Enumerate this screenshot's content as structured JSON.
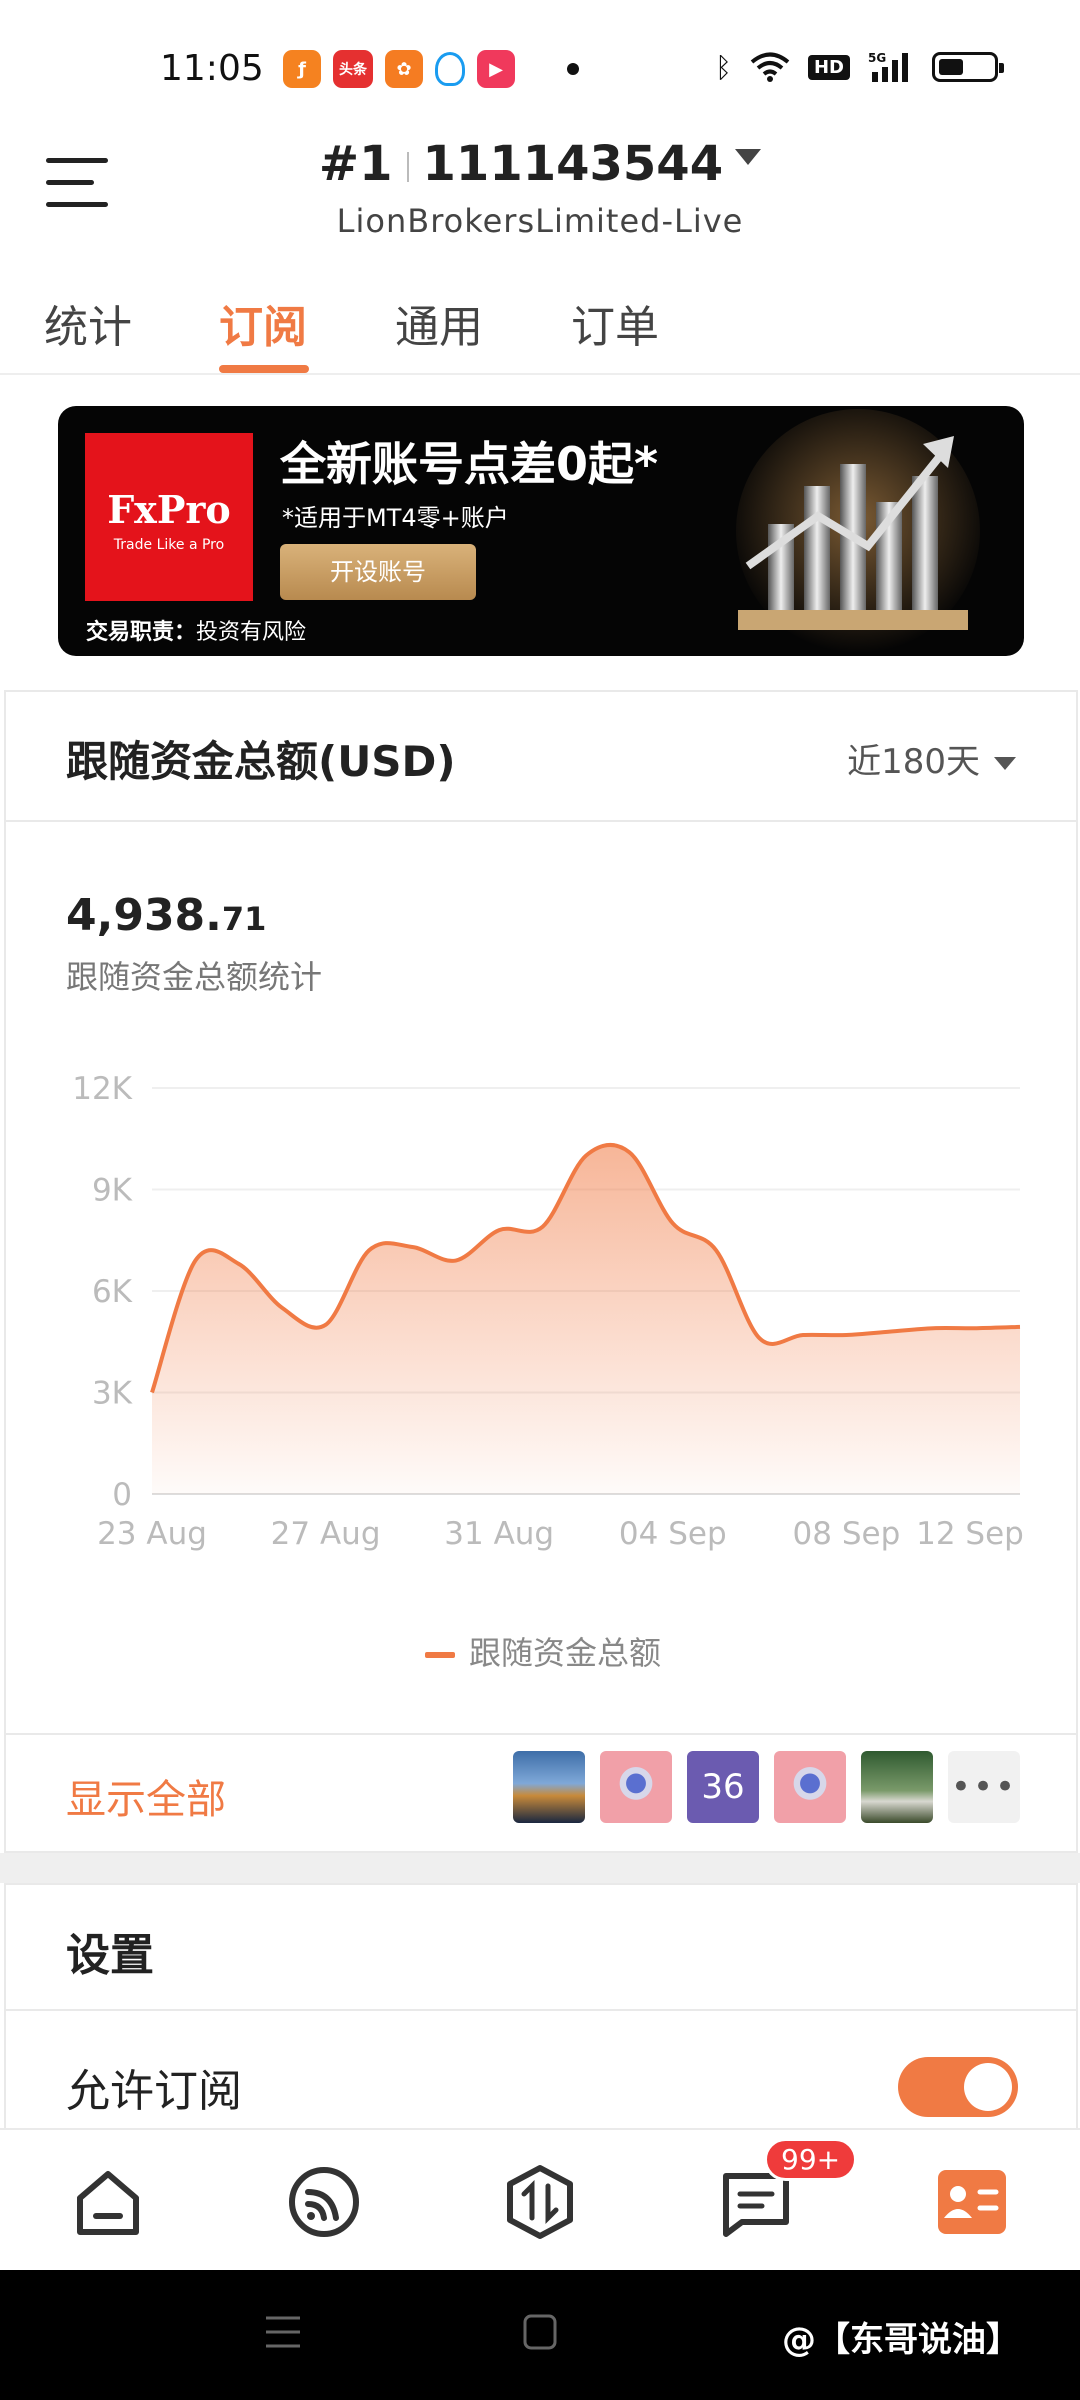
{
  "status_bar": {
    "time": "11:05",
    "app_icons": [
      "flame-app-icon",
      "toutiao-app-icon",
      "fan-app-icon",
      "qq-app-icon",
      "video-app-icon"
    ],
    "toutiao_label": "头条",
    "hd_label": "HD",
    "network_label": "5G"
  },
  "header": {
    "account_index": "#1",
    "account_number": "111143544",
    "server": "LionBrokersLimited-Live"
  },
  "tabs": [
    {
      "label": "统计"
    },
    {
      "label": "订阅"
    },
    {
      "label": "通用"
    },
    {
      "label": "订单"
    }
  ],
  "active_tab": "订阅",
  "banner": {
    "brand": "FxPro",
    "tagline": "Trade Like a Pro",
    "headline": "全新账号点差0起*",
    "subline": "*适用于MT4零+账户",
    "button": "开设账号",
    "risk_label": "交易职责：",
    "risk_text": "投资有风险"
  },
  "funds_card": {
    "title": "跟随资金总额(USD)",
    "range": "近180天",
    "total_int": "4,938.",
    "total_dec": "71",
    "total_label": "跟随资金总额统计",
    "legend": "跟随资金总额"
  },
  "chart_data": {
    "type": "area",
    "title": "",
    "x_ticks": [
      "23 Aug",
      "27 Aug",
      "31 Aug",
      "04 Sep",
      "08 Sep",
      "12 Sep"
    ],
    "y_ticks": [
      "12K",
      "9K",
      "6K",
      "3K",
      "0"
    ],
    "ylim": [
      0,
      12000
    ],
    "grid": true,
    "series": [
      {
        "name": "跟随资金总额",
        "color": "#f07a44",
        "x": [
          "23 Aug",
          "24 Aug",
          "25 Aug",
          "26 Aug",
          "27 Aug",
          "28 Aug",
          "29 Aug",
          "30 Aug",
          "31 Aug",
          "01 Sep",
          "02 Sep",
          "03 Sep",
          "04 Sep",
          "05 Sep",
          "06 Sep",
          "07 Sep",
          "08 Sep",
          "09 Sep",
          "10 Sep",
          "11 Sep",
          "12 Sep"
        ],
        "values": [
          3000,
          6900,
          6800,
          5500,
          5000,
          7200,
          7300,
          6900,
          7800,
          7900,
          10000,
          10100,
          8000,
          7200,
          4600,
          4700,
          4700,
          4800,
          4900,
          4900,
          4939
        ]
      }
    ]
  },
  "followers": {
    "show_all": "显示全部",
    "count": "36",
    "more": "•••"
  },
  "settings": {
    "title": "设置",
    "allow_subscribe": "允许订阅",
    "allow_subscribe_on": true
  },
  "bottom_nav": {
    "items": [
      "home-icon",
      "signals-icon",
      "trade-icon",
      "messages-icon",
      "profile-icon"
    ],
    "badge": "99+"
  },
  "watermark": "@【东哥说油】",
  "colors": {
    "accent": "#f07a44",
    "badge": "#ef3b3b"
  }
}
